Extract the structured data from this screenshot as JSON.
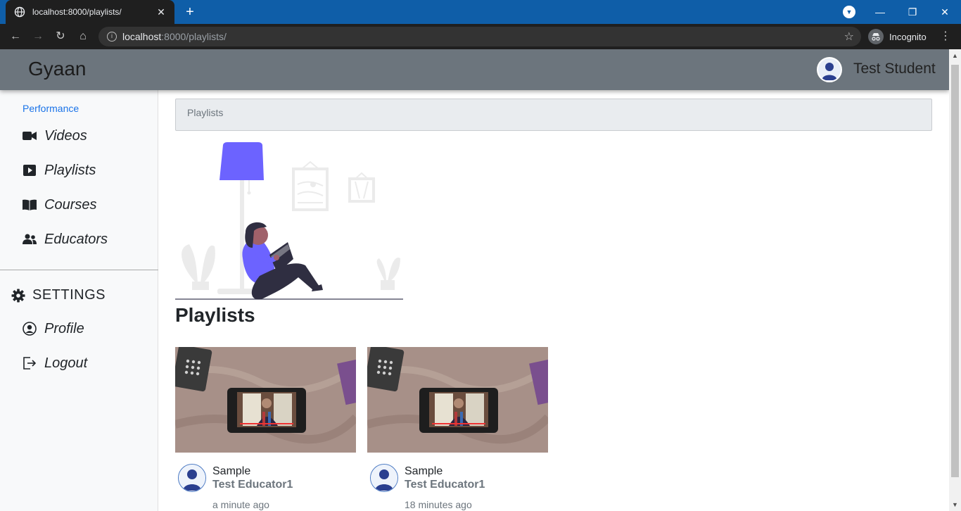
{
  "browser": {
    "tab_title": "localhost:8000/playlists/",
    "url_host": "localhost",
    "url_path": ":8000/playlists/",
    "profile_label": "Incognito"
  },
  "navbar": {
    "brand": "Gyaan",
    "user_name": "Test Student"
  },
  "sidebar": {
    "section_label": "Performance",
    "items": [
      {
        "label": "Videos",
        "icon": "video-camera-icon"
      },
      {
        "label": "Playlists",
        "icon": "play-square-icon"
      },
      {
        "label": "Courses",
        "icon": "open-book-icon"
      },
      {
        "label": "Educators",
        "icon": "users-icon"
      }
    ],
    "settings_label": "SETTINGS",
    "settings_items": [
      {
        "label": "Profile",
        "icon": "user-circle-icon"
      },
      {
        "label": "Logout",
        "icon": "logout-icon"
      }
    ]
  },
  "breadcrumb": "Playlists",
  "page_title": "Playlists",
  "playlists": [
    {
      "title": "Sample",
      "author": "Test Educator1",
      "time": "a minute ago"
    },
    {
      "title": "Sample",
      "author": "Test Educator1",
      "time": "18 minutes ago"
    }
  ],
  "colors": {
    "navbar": "#6c757d",
    "sidebar": "#f8f9fa",
    "accent": "#1a73e8",
    "illustration_accent": "#6c63ff"
  }
}
